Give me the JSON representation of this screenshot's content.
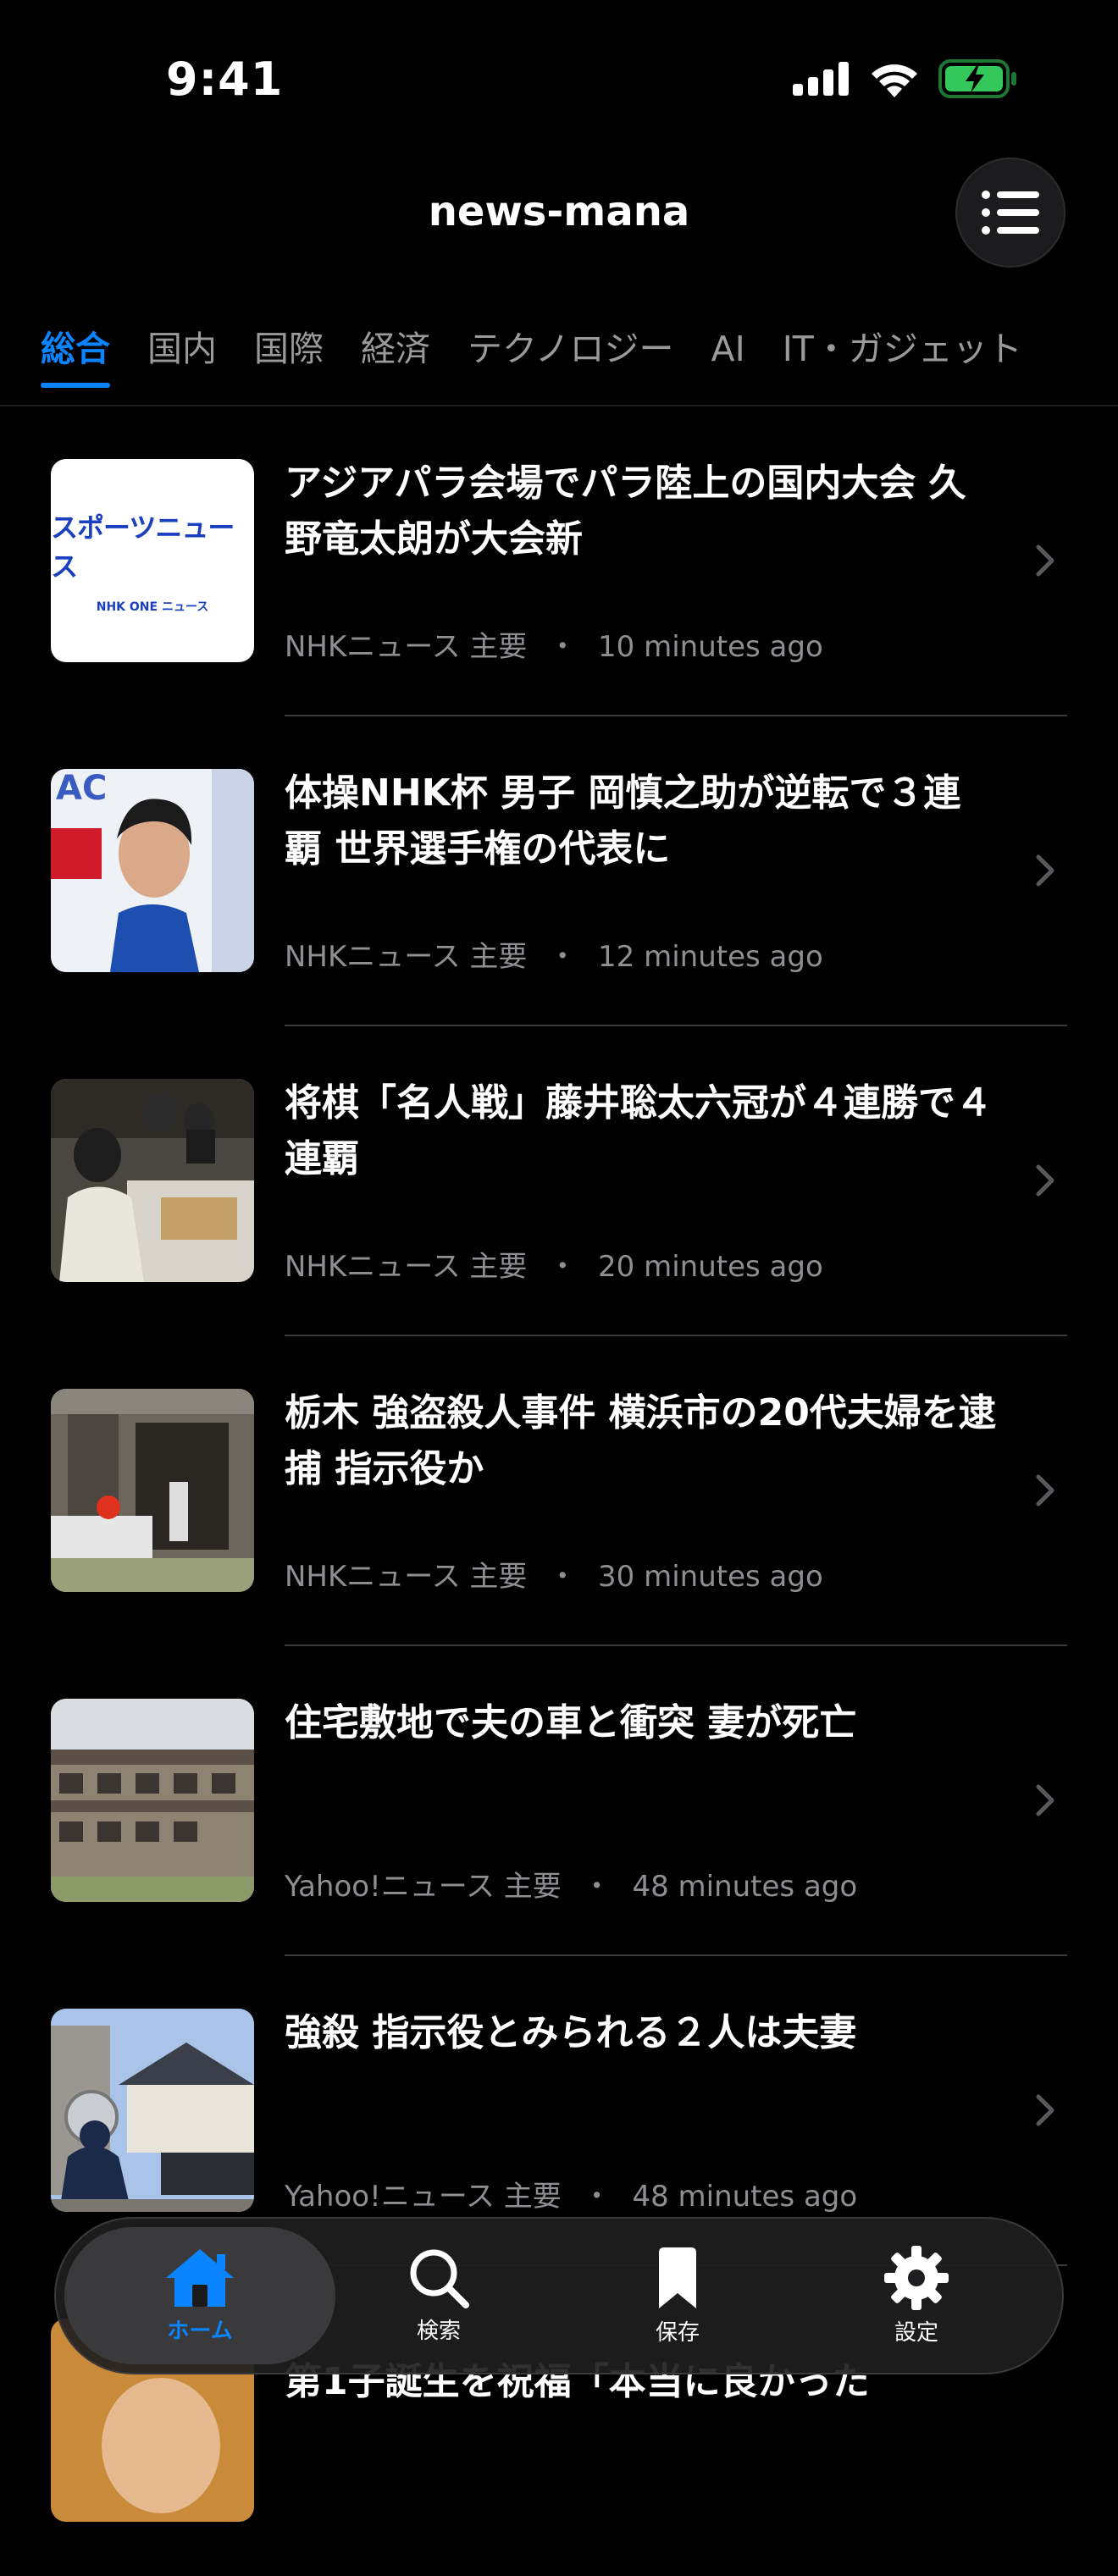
{
  "status_bar": {
    "time": "9:41"
  },
  "header": {
    "title": "news-mana"
  },
  "tabs": [
    {
      "label": "総合",
      "active": true
    },
    {
      "label": "国内"
    },
    {
      "label": "国際"
    },
    {
      "label": "経済"
    },
    {
      "label": "テクノロジー"
    },
    {
      "label": "AI"
    },
    {
      "label": "IT・ガジェット"
    }
  ],
  "articles": [
    {
      "title": "アジアパラ会場でパラ陸上の国内大会 久野竜太朗が大会新",
      "source": "NHKニュース 主要",
      "sep": "・",
      "time": "10 minutes ago",
      "thumb": {
        "kind": "logo",
        "logo_main": "スポーツニュース",
        "logo_sub": "NHK ONE ニュース"
      }
    },
    {
      "title": "体操NHK杯 男子 岡慎之助が逆転で３連覇 世界選手権の代表に",
      "source": "NHKニュース 主要",
      "sep": "・",
      "time": "12 minutes ago",
      "thumb": {
        "kind": "photo",
        "scene": "gymnast"
      }
    },
    {
      "title": "将棋「名人戦」藤井聡太六冠が４連勝で４連覇",
      "source": "NHKニュース 主要",
      "sep": "・",
      "time": "20 minutes ago",
      "thumb": {
        "kind": "photo",
        "scene": "shogi"
      }
    },
    {
      "title": "栃木 強盗殺人事件 横浜市の20代夫婦を逮捕 指示役か",
      "source": "NHKニュース 主要",
      "sep": "・",
      "time": "30 minutes ago",
      "thumb": {
        "kind": "photo",
        "scene": "house"
      }
    },
    {
      "title": "住宅敷地で夫の車と衝突 妻が死亡",
      "source": "Yahoo!ニュース 主要",
      "sep": "・",
      "time": "48 minutes ago",
      "thumb": {
        "kind": "photo",
        "scene": "building"
      }
    },
    {
      "title": "強殺 指示役とみられる２人は夫妻",
      "source": "Yahoo!ニュース 主要",
      "sep": "・",
      "time": "48 minutes ago",
      "thumb": {
        "kind": "photo",
        "scene": "police"
      }
    },
    {
      "title": "第1子誕生を祝福「本当に良かった",
      "source": "",
      "sep": "",
      "time": "",
      "thumb": {
        "kind": "photo",
        "scene": "partial"
      }
    }
  ],
  "tab_bar": [
    {
      "label": "ホーム",
      "icon": "home-icon",
      "active": true
    },
    {
      "label": "検索",
      "icon": "search-icon"
    },
    {
      "label": "保存",
      "icon": "bookmark-icon"
    },
    {
      "label": "設定",
      "icon": "gear-icon"
    }
  ],
  "colors": {
    "accent": "#0a84ff",
    "background": "#000000",
    "battery": "#34c759"
  }
}
